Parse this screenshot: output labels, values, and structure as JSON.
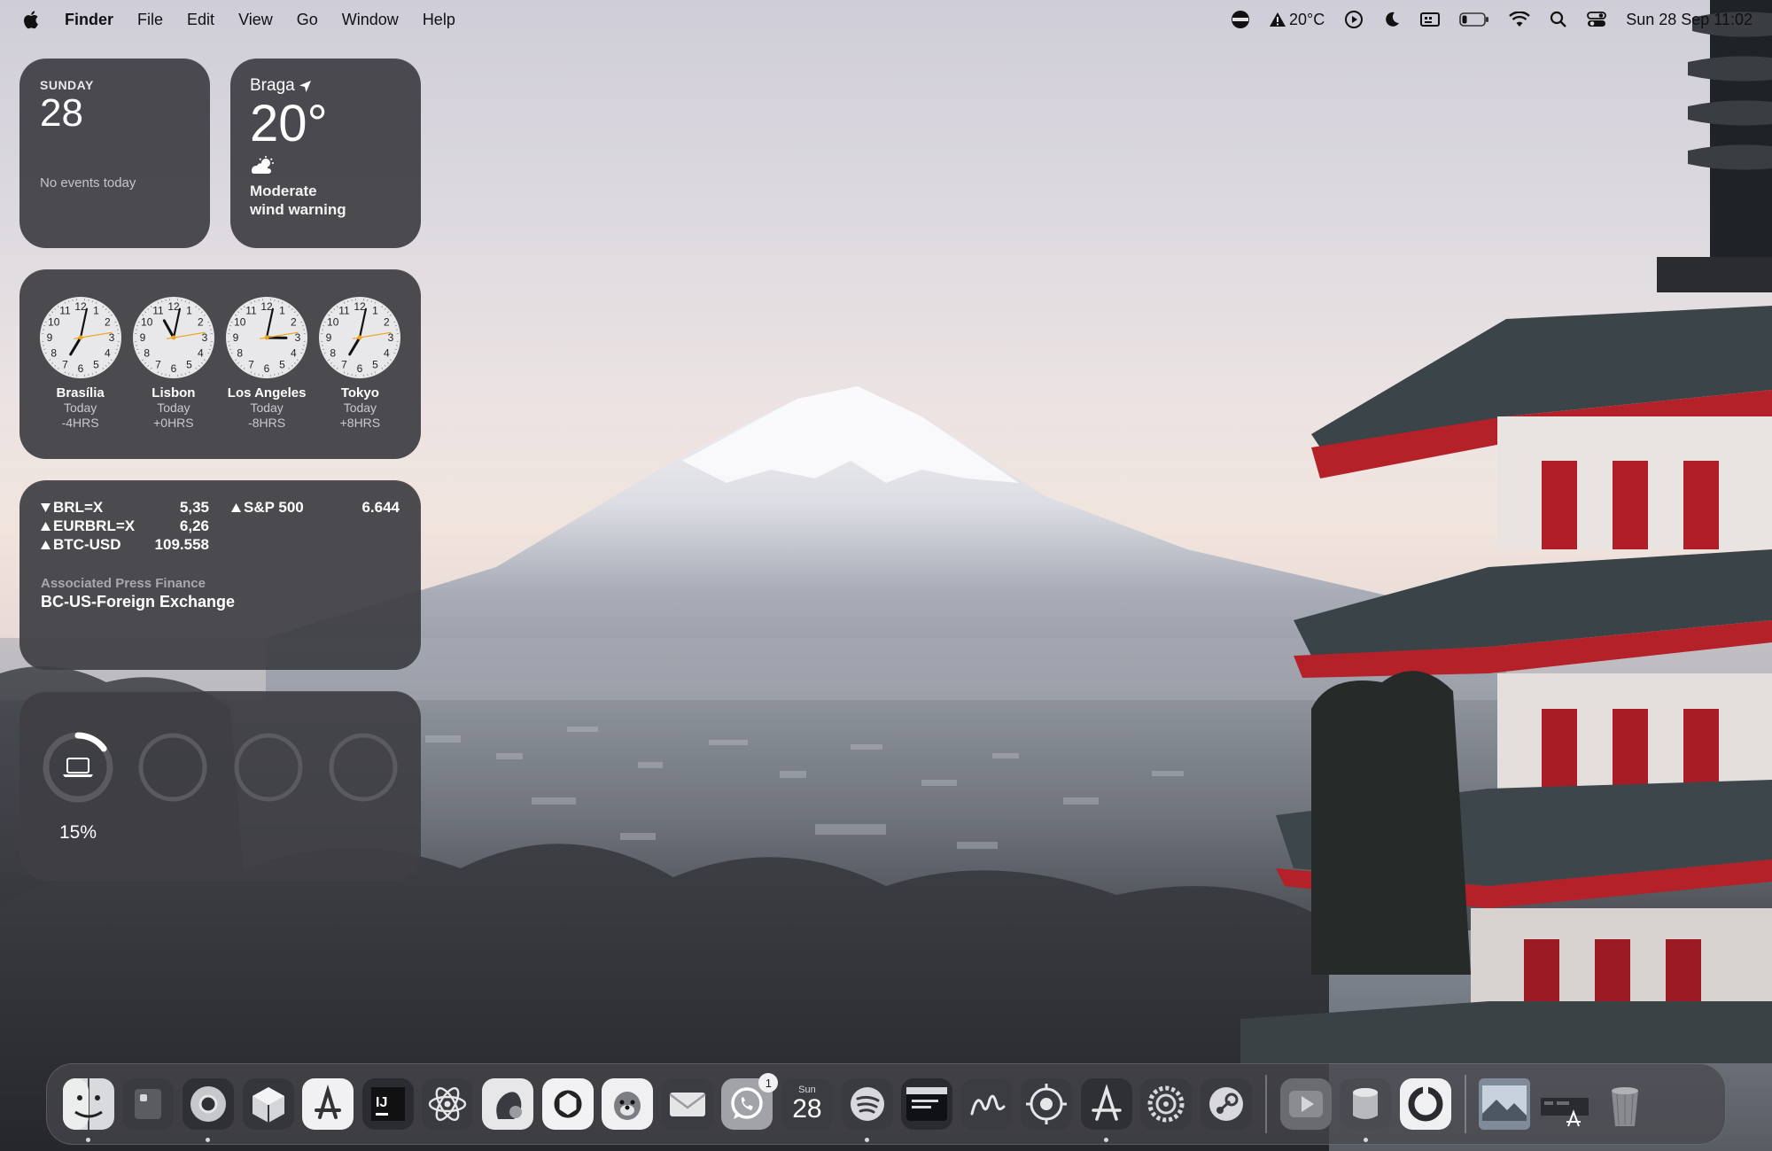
{
  "menubar": {
    "app_name": "Finder",
    "menus": [
      "File",
      "Edit",
      "View",
      "Go",
      "Window",
      "Help"
    ],
    "temperature": "20°C",
    "datetime": "Sun 28 Sep  11:02"
  },
  "widgets": {
    "calendar": {
      "day": "SUNDAY",
      "date": "28",
      "events": "No events today"
    },
    "weather": {
      "city": "Braga",
      "temp": "20°",
      "condition_line1": "Moderate",
      "condition_line2": "wind warning"
    },
    "clocks": [
      {
        "city": "Brasília",
        "day": "Today",
        "offset": "-4HRS",
        "hour": 7,
        "minute": 2
      },
      {
        "city": "Lisbon",
        "day": "Today",
        "offset": "+0HRS",
        "hour": 11,
        "minute": 2
      },
      {
        "city": "Los Angeles",
        "day": "Today",
        "offset": "-8HRS",
        "hour": 3,
        "minute": 2
      },
      {
        "city": "Tokyo",
        "day": "Today",
        "offset": "+8HRS",
        "hour": 7,
        "minute": 2
      }
    ],
    "stocks": {
      "left": [
        {
          "symbol": "BRL=X",
          "value": "5,35",
          "trend": "down"
        },
        {
          "symbol": "EURBRL=X",
          "value": "6,26",
          "trend": "up"
        },
        {
          "symbol": "BTC-USD",
          "value": "109.558",
          "trend": "up"
        }
      ],
      "right": [
        {
          "symbol": "S&P 500",
          "value": "6.644",
          "trend": "up"
        }
      ],
      "source": "Associated Press Finance",
      "headline": "BC-US-Foreign Exchange"
    },
    "battery": {
      "percent_label": "15%",
      "level": 0.15
    }
  },
  "dock": {
    "items": [
      {
        "name": "finder-icon",
        "running": true
      },
      {
        "name": "storage-icon",
        "running": false
      },
      {
        "name": "chrome-icon",
        "running": true
      },
      {
        "name": "box-icon",
        "running": false
      },
      {
        "name": "app-store-icon",
        "running": false
      },
      {
        "name": "intellij-icon",
        "running": false
      },
      {
        "name": "atom-icon",
        "running": false
      },
      {
        "name": "squirrel-icon",
        "running": false
      },
      {
        "name": "chatgpt-icon",
        "running": false
      },
      {
        "name": "dog-icon",
        "running": false
      },
      {
        "name": "mail-icon",
        "running": false
      },
      {
        "name": "whatsapp-icon",
        "running": false,
        "badge": "1"
      },
      {
        "name": "calendar-icon",
        "running": false,
        "month": "Sun",
        "day": "28"
      },
      {
        "name": "spotify-icon",
        "running": true
      },
      {
        "name": "text-editor-icon",
        "running": false
      },
      {
        "name": "signature-icon",
        "running": false
      },
      {
        "name": "openai-icon",
        "running": false
      },
      {
        "name": "xcode-tool-icon",
        "running": true
      },
      {
        "name": "settings-icon",
        "running": false
      },
      {
        "name": "steam-icon",
        "running": false
      },
      {
        "name": "video-icon",
        "running": false
      },
      {
        "name": "database-icon",
        "running": true
      },
      {
        "name": "ring-app-icon",
        "running": false
      },
      {
        "name": "preview-folder-icon",
        "running": false
      },
      {
        "name": "applications-folder-icon",
        "running": false
      },
      {
        "name": "trash-icon",
        "running": false
      }
    ]
  }
}
